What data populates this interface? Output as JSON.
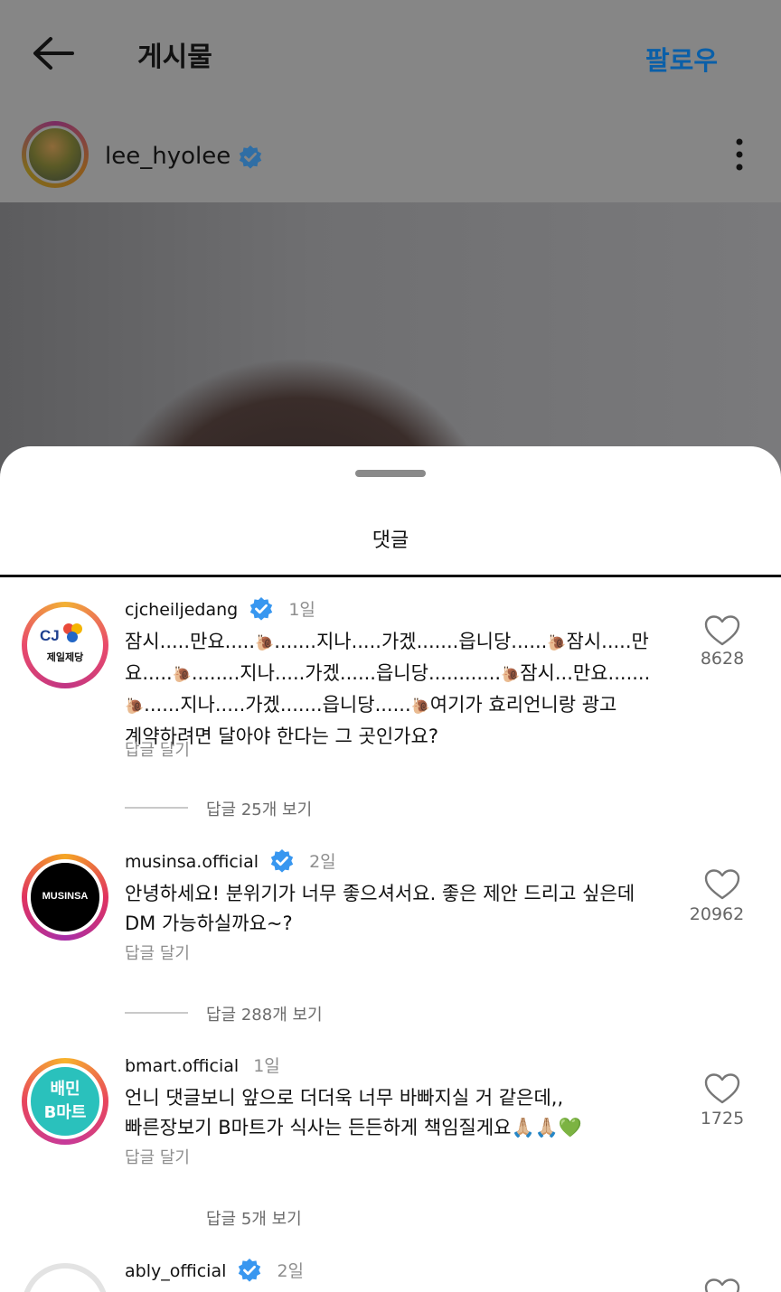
{
  "header": {
    "title": "게시물",
    "follow_label": "팔로우"
  },
  "post": {
    "username": "lee_hyolee"
  },
  "sheet": {
    "title": "댓글"
  },
  "comments": [
    {
      "username": "cjcheiljedang",
      "verified": true,
      "time": "1일",
      "avatar_text_1": "CJ",
      "avatar_text_2": "제일제당",
      "lines": [
        [
          "잠시.....만요.....",
          "🐌",
          ".......지나.....가겠.......읍니당......",
          "🐌",
          "잠시.....만"
        ],
        [
          "요.....",
          "🐌",
          "........지나.....가겠......읍니당............",
          "🐌",
          "잠시...만요......."
        ],
        [
          "",
          "🐌",
          "......지나.....가겠.......읍니당......",
          "🐌",
          "여기가 효리언니랑 광고"
        ],
        [
          "계약하려면 달아야 한다는 그 곳인가요?"
        ]
      ],
      "reply_label": "답글 달기",
      "likes": "8628",
      "view_replies": "답글 25개 보기"
    },
    {
      "username": "musinsa.official",
      "verified": true,
      "time": "2일",
      "avatar_text_1": "MUSINSA",
      "lines": [
        [
          "안녕하세요! 분위기가 너무 좋으셔서요. 좋은 제안 드리고 싶은데"
        ],
        [
          "DM 가능하실까요~?"
        ]
      ],
      "reply_label": "답글 달기",
      "likes": "20962",
      "view_replies": "답글 288개 보기"
    },
    {
      "username": "bmart.official",
      "verified": false,
      "time": "1일",
      "avatar_text_1": "배민",
      "avatar_text_2": "B마트",
      "lines": [
        [
          "언니 댓글보니 앞으로 더더욱 너무 바빠지실 거 같은데,,"
        ],
        [
          "빠른장보기 B마트가 식사는 든든하게 책임질게요🙏🏼🙏🏼💚"
        ]
      ],
      "reply_label": "답글 달기",
      "likes": "1725",
      "view_replies": "답글 5개 보기"
    },
    {
      "username": "ably_official",
      "verified": true,
      "time": "2일"
    }
  ],
  "colors": {
    "accent": "#0095f6",
    "verified": "#3897f0",
    "follow": "#0a5fa8"
  },
  "icons": {
    "back": "back-arrow-icon",
    "more": "more-vertical-icon",
    "like": "heart-icon",
    "verified": "verified-badge-icon"
  }
}
